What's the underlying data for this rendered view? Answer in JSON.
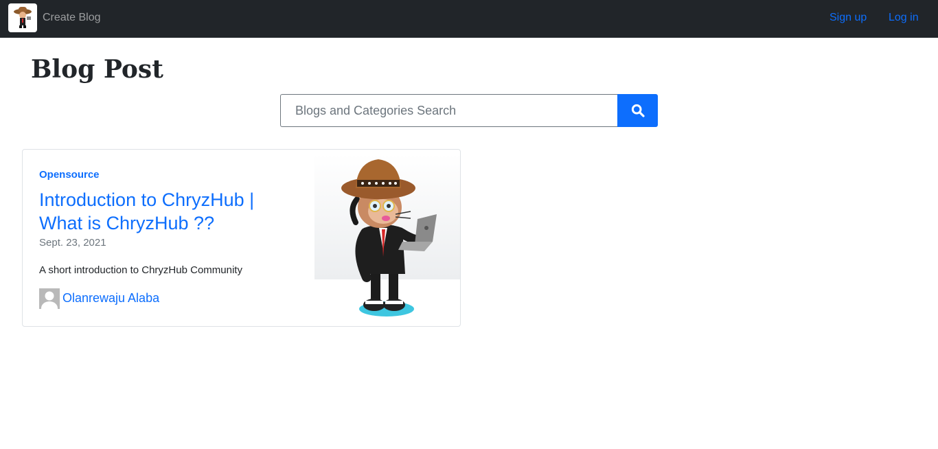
{
  "navbar": {
    "brand_icon": "octocat-cowboy-logo",
    "create_blog_label": "Create Blog",
    "signup_label": "Sign up",
    "login_label": "Log in",
    "background": "#212529",
    "link_color": "#0d6efd"
  },
  "page": {
    "title": "Blog Post"
  },
  "search": {
    "placeholder": "Blogs and Categories Search",
    "value": "",
    "button_icon": "search-icon",
    "button_color": "#0d6efd"
  },
  "posts": [
    {
      "category": "Opensource",
      "title": "Introduction to ChryzHub | What is ChryzHub ??",
      "date": "Sept. 23, 2021",
      "excerpt": "A short introduction to ChryzHub Community",
      "author": "Olanrewaju Alaba",
      "author_avatar_icon": "default-avatar-icon",
      "image_icon": "octocat-cowboy-illustration"
    }
  ]
}
